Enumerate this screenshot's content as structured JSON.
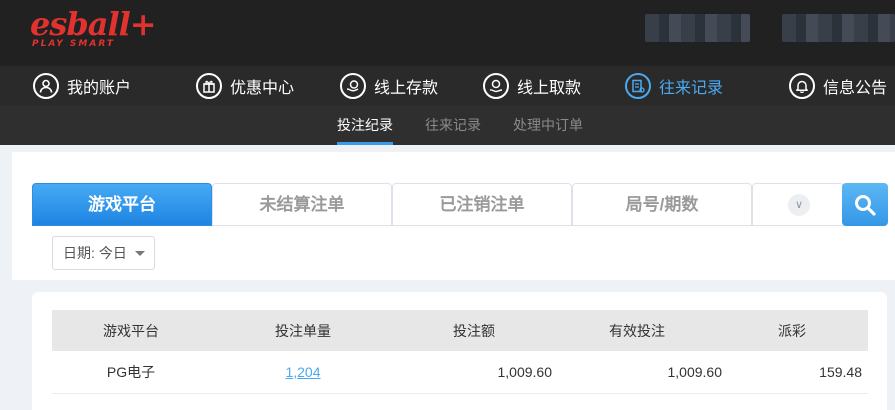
{
  "brand": {
    "logo_text": "esball+",
    "logo_subtext": "PLAY SMART",
    "color": "#e0322e"
  },
  "main_nav": [
    {
      "label": "我的账户",
      "icon": "user-icon",
      "active": false
    },
    {
      "label": "优惠中心",
      "icon": "gift-icon",
      "active": false
    },
    {
      "label": "线上存款",
      "icon": "deposit-icon",
      "active": false
    },
    {
      "label": "线上取款",
      "icon": "withdraw-icon",
      "active": false
    },
    {
      "label": "往来记录",
      "icon": "records-icon",
      "active": true
    },
    {
      "label": "信息公告",
      "icon": "bell-icon",
      "active": false
    }
  ],
  "sub_nav": [
    {
      "label": "投注纪录",
      "active": true
    },
    {
      "label": "往来记录",
      "active": false
    },
    {
      "label": "处理中订单",
      "active": false
    }
  ],
  "filter_tabs": [
    {
      "label": "游戏平台",
      "active": true
    },
    {
      "label": "未结算注单",
      "active": false
    },
    {
      "label": "已注销注单",
      "active": false
    },
    {
      "label": "局号/期数",
      "active": false
    }
  ],
  "date_filter": {
    "label": "日期:",
    "value": "今日"
  },
  "table": {
    "headers": [
      "游戏平台",
      "投注单量",
      "投注额",
      "有效投注",
      "派彩"
    ],
    "rows": [
      {
        "platform": "PG电子",
        "count": "1,204",
        "amount": "1,009.60",
        "valid": "1,009.60",
        "payout": "159.48"
      }
    ]
  },
  "colors": {
    "accent": "#4aa9f2",
    "tab_active": "#2b8de6",
    "header_bg": "#212121"
  }
}
